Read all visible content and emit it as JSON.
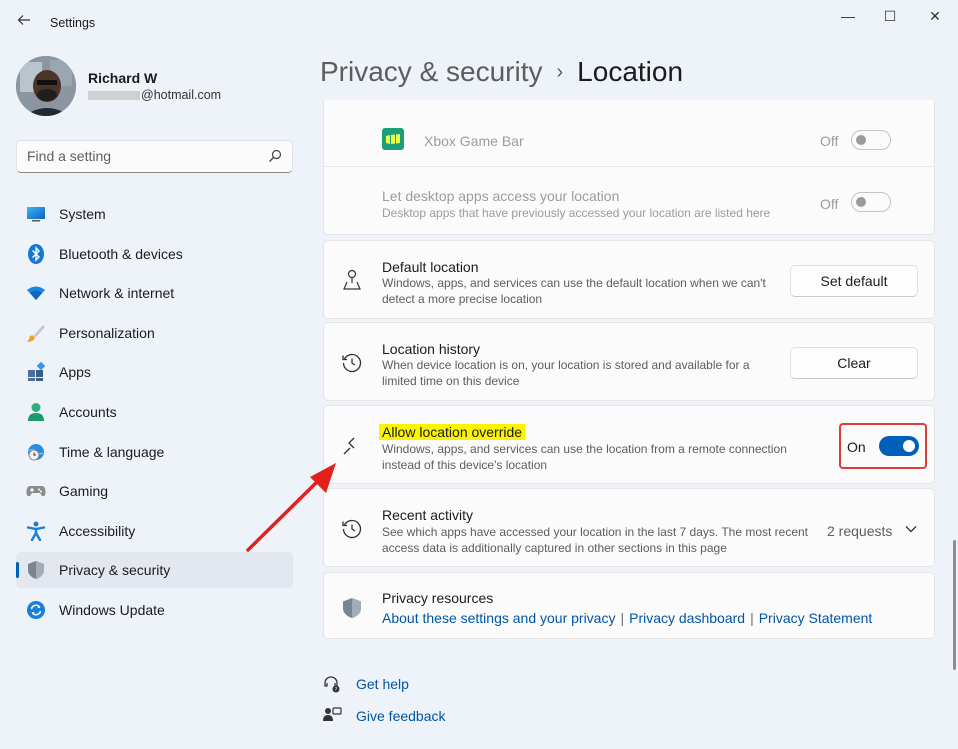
{
  "window": {
    "title": "Settings",
    "controls": {
      "minimize": "—",
      "maximize": "☐",
      "close": "✕"
    }
  },
  "profile": {
    "name": "Richard W",
    "email_suffix": "@hotmail.com"
  },
  "search": {
    "placeholder": "Find a setting"
  },
  "sidebar": {
    "items": [
      {
        "label": "System",
        "icon": "system-icon"
      },
      {
        "label": "Bluetooth & devices",
        "icon": "bluetooth-icon"
      },
      {
        "label": "Network & internet",
        "icon": "wifi-icon"
      },
      {
        "label": "Personalization",
        "icon": "brush-icon"
      },
      {
        "label": "Apps",
        "icon": "apps-icon"
      },
      {
        "label": "Accounts",
        "icon": "person-icon"
      },
      {
        "label": "Time & language",
        "icon": "globe-clock-icon"
      },
      {
        "label": "Gaming",
        "icon": "gamepad-icon"
      },
      {
        "label": "Accessibility",
        "icon": "accessibility-icon"
      },
      {
        "label": "Privacy & security",
        "icon": "shield-icon",
        "active": true
      },
      {
        "label": "Windows Update",
        "icon": "update-icon"
      }
    ]
  },
  "header": {
    "parent": "Privacy & security",
    "separator": "›",
    "current": "Location"
  },
  "settings": {
    "xbox": {
      "label": "Xbox Game Bar",
      "state": "Off",
      "enabled": false
    },
    "desktop_apps": {
      "title": "Let desktop apps access your location",
      "desc": "Desktop apps that have previously accessed your location are listed here",
      "state": "Off",
      "enabled": false
    },
    "default_location": {
      "title": "Default location",
      "desc_line1": "Windows, apps, and services can use the default location when we can't",
      "desc_line2": "detect a more precise location",
      "button": "Set default"
    },
    "location_history": {
      "title": "Location history",
      "desc_line1": "When device location is on, your location is stored and available for a",
      "desc_line2": "limited time on this device",
      "button": "Clear"
    },
    "location_override": {
      "title": "Allow location override",
      "desc_line1": "Windows, apps, and services can use the location from a remote connection",
      "desc_line2": "instead of this device's location",
      "state": "On",
      "enabled": true
    },
    "recent_activity": {
      "title": "Recent activity",
      "desc_line1": "See which apps have accessed your location in the last 7 days. The most recent",
      "desc_line2": "access data is additionally captured in other sections in this page",
      "count": "2 requests"
    },
    "privacy_resources": {
      "title": "Privacy resources",
      "links": [
        "About these settings and your privacy",
        "Privacy dashboard",
        "Privacy Statement"
      ],
      "separator": "|"
    }
  },
  "footer": {
    "help": "Get help",
    "feedback": "Give feedback"
  },
  "colors": {
    "accent": "#005fb8",
    "highlight": "#fbf400",
    "annotation": "#e03c3c"
  }
}
